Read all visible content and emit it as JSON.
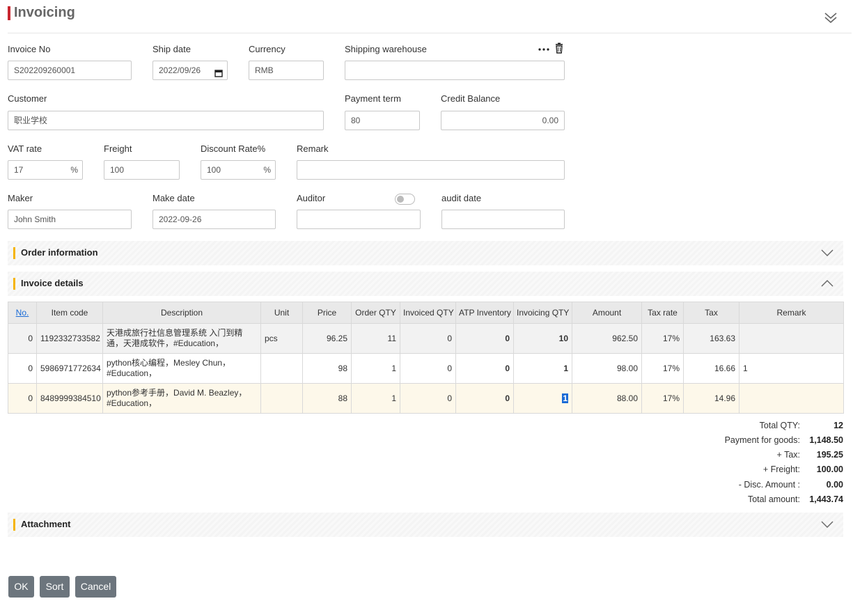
{
  "page": {
    "title": "Invoicing"
  },
  "form": {
    "invoice_no": {
      "label": "Invoice No",
      "value": "S202209260001"
    },
    "ship_date": {
      "label": "Ship date",
      "value": "2022/09/26"
    },
    "currency": {
      "label": "Currency",
      "value": "RMB"
    },
    "shipping_warehouse": {
      "label": "Shipping warehouse",
      "value": ""
    },
    "customer": {
      "label": "Customer",
      "value": "职业学校"
    },
    "payment_term": {
      "label": "Payment term",
      "value": "80"
    },
    "credit_balance": {
      "label": "Credit Balance",
      "value": "0.00"
    },
    "vat_rate": {
      "label": "VAT rate",
      "value": "17",
      "suffix": "%"
    },
    "freight": {
      "label": "Freight",
      "value": "100"
    },
    "discount_rate": {
      "label": "Discount Rate%",
      "value": "100",
      "suffix": "%"
    },
    "remark": {
      "label": "Remark",
      "value": ""
    },
    "maker": {
      "label": "Maker",
      "value": "John Smith"
    },
    "make_date": {
      "label": "Make date",
      "value": "2022-09-26"
    },
    "auditor": {
      "label": "Auditor",
      "value": "",
      "toggle_on": false
    },
    "audit_date": {
      "label": "audit date",
      "value": ""
    }
  },
  "sections": {
    "order_info": "Order information",
    "invoice_details": "Invoice details",
    "attachment": "Attachment"
  },
  "table": {
    "headers": [
      "No.",
      "Item code",
      "Description",
      "Unit",
      "Price",
      "Order QTY",
      "Invoiced QTY",
      "ATP Inventory",
      "Invoicing QTY",
      "Amount",
      "Tax rate",
      "Tax",
      "Remark"
    ],
    "rows": [
      {
        "no": "0",
        "item_code": "1192332733582",
        "desc1": "天港成旅行社信息管理系统 入门到精",
        "desc2": "通，天港成软件，#Education，",
        "unit": "pcs",
        "price": "96.25",
        "order_qty": "11",
        "invoiced_qty": "0",
        "atp": "0",
        "invoicing_qty": "10",
        "amount": "962.50",
        "tax_rate": "17%",
        "tax": "163.63",
        "remark": ""
      },
      {
        "no": "0",
        "item_code": "5986971772634",
        "desc1": "python核心编程，Mesley Chun，",
        "desc2": "#Education，",
        "unit": "",
        "price": "98",
        "order_qty": "1",
        "invoiced_qty": "0",
        "atp": "0",
        "invoicing_qty": "1",
        "amount": "98.00",
        "tax_rate": "17%",
        "tax": "16.66",
        "remark": "1"
      },
      {
        "no": "0",
        "item_code": "8489999384510",
        "desc1": "python参考手册，David M. Beazley，",
        "desc2": "#Education，",
        "unit": "",
        "price": "88",
        "order_qty": "1",
        "invoiced_qty": "0",
        "atp": "0",
        "invoicing_qty": "1",
        "amount": "88.00",
        "tax_rate": "17%",
        "tax": "14.96",
        "remark": ""
      }
    ]
  },
  "summary": {
    "total_qty": {
      "label": "Total QTY:",
      "value": "12"
    },
    "payment_for_goods": {
      "label": "Payment for goods:",
      "value": "1,148.50"
    },
    "tax": {
      "label": "+ Tax:",
      "value": "195.25"
    },
    "freight": {
      "label": "+ Freight:",
      "value": "100.00"
    },
    "disc_amount": {
      "label": "- Disc. Amount :",
      "value": "0.00"
    },
    "total_amount": {
      "label": "Total amount:",
      "value": "1,443.74"
    }
  },
  "buttons": {
    "ok": "OK",
    "sort": "Sort",
    "cancel": "Cancel"
  },
  "colors": {
    "title_accent": "#c8262f",
    "section_accent": "#f5b400",
    "button_bg": "#6c757d",
    "link": "#1a6bd6"
  }
}
